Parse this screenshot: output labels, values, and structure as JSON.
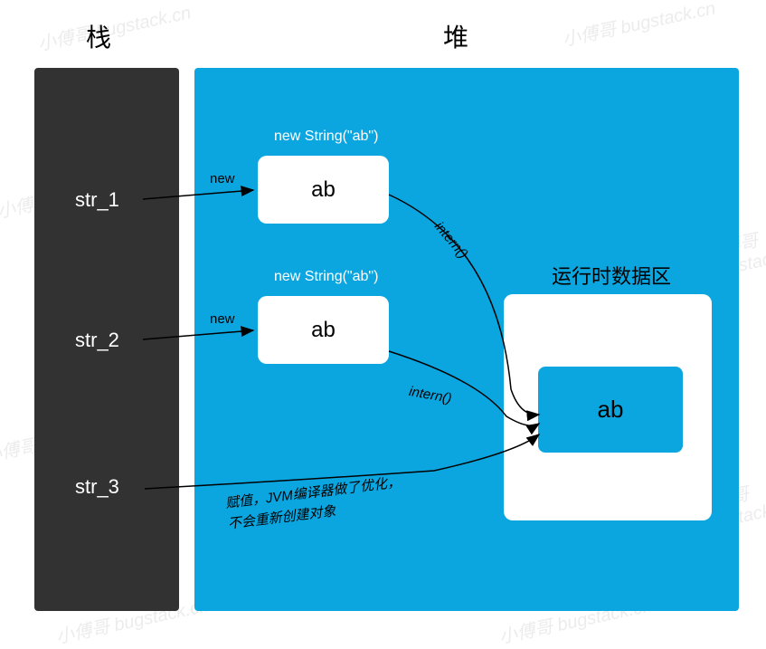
{
  "titles": {
    "stack": "栈",
    "heap": "堆"
  },
  "watermark": {
    "text": "小傅哥 bugstack.cn"
  },
  "stack_vars": {
    "var1": "str_1",
    "var2": "str_2",
    "var3": "str_3"
  },
  "heap_objects": {
    "string_label1": "new String(\"ab\")",
    "string_box1": "ab",
    "string_label2": "new String(\"ab\")",
    "string_box2": "ab"
  },
  "runtime": {
    "label": "运行时数据区",
    "pool_value": "ab"
  },
  "edges": {
    "new1": "new",
    "new2": "new",
    "intern1": "intern()",
    "intern2": "intern()",
    "jvm_note_line1": "赋值，JVM编译器做了优化，",
    "jvm_note_line2": "不会重新创建对象"
  }
}
